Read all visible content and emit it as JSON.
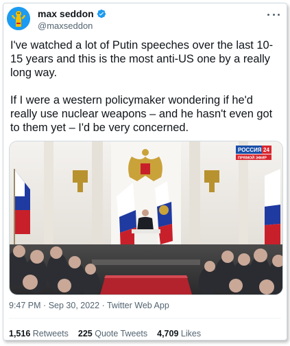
{
  "author": {
    "name": "max seddon",
    "handle": "@maxseddon",
    "avatar_icon": "cartoon-avatar-icon",
    "verified_icon": "verified-badge-icon"
  },
  "tweet": {
    "paragraph_1": "I've watched a lot of Putin speeches over the last 10-15 years and this is the most anti-US one by a really long way.",
    "paragraph_2": "If I were a western policymaker wondering if he'd really use nuclear weapons – and he hasn't even got to them yet – I'd be very concerned."
  },
  "media": {
    "tv_logo_name": "РОССИЯ",
    "tv_logo_number": "24",
    "tv_live_label": "ПРЯМОЙ ЭФИР"
  },
  "meta": {
    "time": "9:47 PM",
    "separator_1": "·",
    "date": "Sep 30, 2022",
    "separator_2": "·",
    "source": "Twitter Web App"
  },
  "stats": {
    "retweets_count": "1,516",
    "retweets_label": "Retweets",
    "quotes_count": "225",
    "quotes_label": "Quote Tweets",
    "likes_count": "4,709",
    "likes_label": "Likes"
  },
  "colors": {
    "accent": "#1d9bf0",
    "text": "#0f1419",
    "secondary": "#536471"
  }
}
